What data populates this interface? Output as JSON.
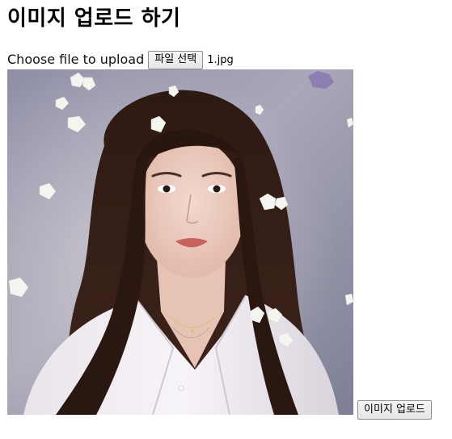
{
  "page": {
    "title": "이미지 업로드 하기"
  },
  "upload": {
    "label": "Choose file to upload",
    "choose_button": "파일 선택",
    "file_name": "1.jpg",
    "submit_button": "이미지 업로드"
  },
  "preview": {
    "description": "photo"
  },
  "colors": {
    "button_border": "#8f8f8f",
    "button_bg": "#efefef"
  }
}
